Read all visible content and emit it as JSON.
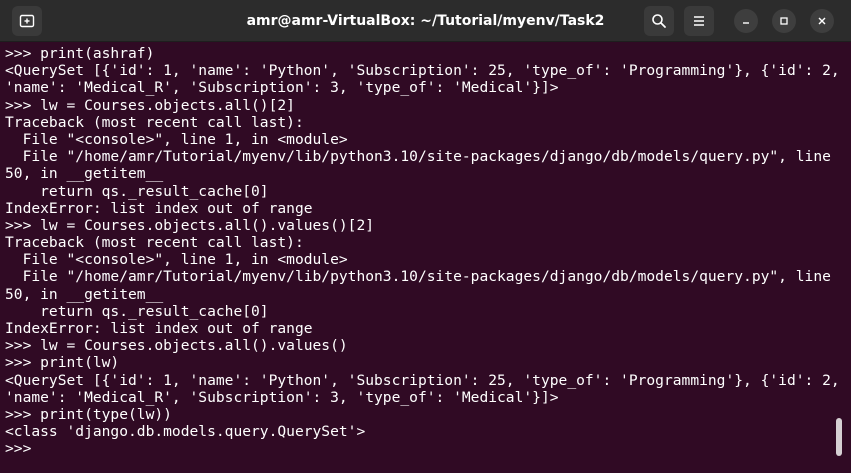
{
  "window": {
    "title": "amr@amr-VirtualBox: ~/Tutorial/myenv/Task2"
  },
  "titlebar": {
    "icons": {
      "new_tab": "new-tab-icon",
      "search": "search-icon",
      "menu": "hamburger-menu-icon",
      "minimize": "minimize-icon",
      "maximize": "maximize-icon",
      "close": "close-icon"
    }
  },
  "colors": {
    "terminal_background": "#300a24",
    "terminal_text": "#ffffff",
    "titlebar_background": "#2c2c2c"
  },
  "terminal": {
    "lines": [
      ">>> print(ashraf)",
      "<QuerySet [{'id': 1, 'name': 'Python', 'Subscription': 25, 'type_of': 'Programming'}, {'id': 2,",
      "'name': 'Medical_R', 'Subscription': 3, 'type_of': 'Medical'}]>",
      ">>> lw = Courses.objects.all()[2]",
      "Traceback (most recent call last):",
      "  File \"<console>\", line 1, in <module>",
      "  File \"/home/amr/Tutorial/myenv/lib/python3.10/site-packages/django/db/models/query.py\", line 4",
      "50, in __getitem__",
      "    return qs._result_cache[0]",
      "IndexError: list index out of range",
      ">>> lw = Courses.objects.all().values()[2]",
      "Traceback (most recent call last):",
      "  File \"<console>\", line 1, in <module>",
      "  File \"/home/amr/Tutorial/myenv/lib/python3.10/site-packages/django/db/models/query.py\", line 4",
      "50, in __getitem__",
      "    return qs._result_cache[0]",
      "IndexError: list index out of range",
      ">>> lw = Courses.objects.all().values()",
      ">>> print(lw)",
      "<QuerySet [{'id': 1, 'name': 'Python', 'Subscription': 25, 'type_of': 'Programming'}, {'id': 2,",
      "'name': 'Medical_R', 'Subscription': 3, 'type_of': 'Medical'}]>",
      ">>> print(type(lw))",
      "<class 'django.db.models.query.QuerySet'>",
      ">>> "
    ]
  }
}
